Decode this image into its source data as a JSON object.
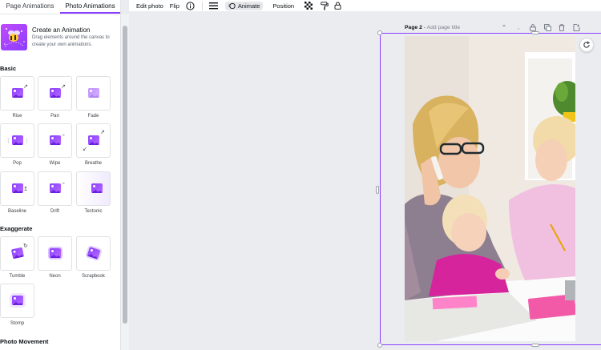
{
  "panel": {
    "tabs": [
      {
        "label": "Page Animations"
      },
      {
        "label": "Photo Animations"
      }
    ],
    "create": {
      "title": "Create an Animation",
      "description": "Drag elements around the canvas to create your own animations."
    },
    "sections": [
      {
        "title": "Basic"
      },
      {
        "title": "Exaggerate"
      },
      {
        "title": "Photo Movement"
      }
    ],
    "basic": [
      {
        "label": "Rise"
      },
      {
        "label": "Pan"
      },
      {
        "label": "Fade"
      },
      {
        "label": "Pop"
      },
      {
        "label": "Wipe"
      },
      {
        "label": "Breathe"
      },
      {
        "label": "Baseline"
      },
      {
        "label": "Drift"
      },
      {
        "label": "Tectonic"
      }
    ],
    "exaggerate": [
      {
        "label": "Tumble"
      },
      {
        "label": "Neon"
      },
      {
        "label": "Scrapbook"
      },
      {
        "label": "Stomp"
      }
    ]
  },
  "toolbar": {
    "edit_photo": "Edit photo",
    "flip": "Flip",
    "info_icon": "info-icon",
    "animate": "Animate",
    "position": "Position",
    "accent": "#8b3dff"
  },
  "page": {
    "number_label": "Page 2",
    "separator": " - ",
    "title_placeholder": "Add page title"
  },
  "colors": {
    "accent": "#8b3dff",
    "canvas_bg": "#ebecf0",
    "panel_bg": "#ffffff"
  }
}
